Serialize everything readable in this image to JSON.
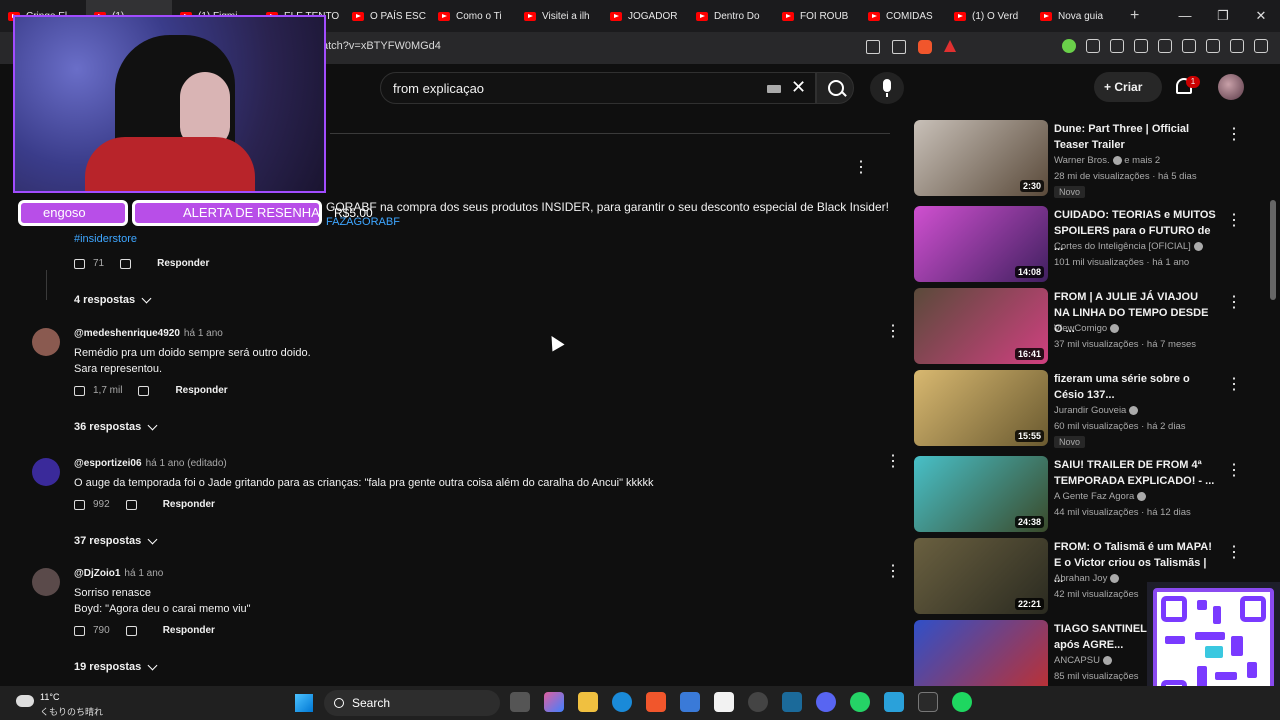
{
  "browser": {
    "tabs": [
      {
        "label": "Cringe El"
      },
      {
        "label": "(1)"
      },
      {
        "label": "(1) Figmi"
      },
      {
        "label": "ELE TENTO"
      },
      {
        "label": "O PAÍS ESC"
      },
      {
        "label": "Como o Ti"
      },
      {
        "label": "Visitei a ilh"
      },
      {
        "label": "JOGADOR"
      },
      {
        "label": "Dentro Do"
      },
      {
        "label": "FOI ROUB"
      },
      {
        "label": "COMIDAS"
      },
      {
        "label": "(1) O Verd"
      },
      {
        "label": "Nova guia"
      }
    ],
    "new_tab": "+",
    "window_controls": {
      "minimize": "—",
      "maximize": "❐",
      "close": "✕"
    },
    "url": "atch?v=xBTYFW0MGd4"
  },
  "header": {
    "search_value": "from explicaçao",
    "clear_icon": "✕",
    "create_label": "Criar",
    "create_plus": "+",
    "notif_count": "1"
  },
  "overlay": {
    "alert_user": "engoso",
    "alert_title": "ALERTA DE RESENHA",
    "alert_amount": "R$5.00"
  },
  "pinned": {
    "text": "GORABF na compra dos seus produtos INSIDER, para garantir o seu desconto especial de Black Insider!",
    "link": "FAZAGORABF",
    "hashtag": "#insiderstore",
    "likes": "71",
    "reply_label": "Responder",
    "replies": "4 respostas"
  },
  "comments": [
    {
      "author": "@medeshenrique4920",
      "when": "há 1 ano",
      "text": "Remédio pra um doido sempre será outro doido.\nSara representou.",
      "likes": "1,7 mil",
      "reply_label": "Responder",
      "replies": "36 respostas",
      "avatar_color": "#8a5a50"
    },
    {
      "author": "@esportizei06",
      "when": "há 1 ano (editado)",
      "text": "O auge da temporada foi o Jade gritando para as crianças: \"fala pra gente outra coisa além do caralha do Ancui\" kkkkk",
      "likes": "992",
      "reply_label": "Responder",
      "replies": "37 respostas",
      "avatar_color": "#3a2a9a"
    },
    {
      "author": "@DjZoio1",
      "when": "há 1 ano",
      "text": "Sorriso renasce\nBoyd: \"Agora deu o carai memo viu\"",
      "likes": "790",
      "reply_label": "Responder",
      "replies": "19 respostas",
      "avatar_color": "#5a4a4a"
    }
  ],
  "recommendations": [
    {
      "title": "Dune: Part Three | Official Teaser Trailer",
      "channel": "Warner Bros.",
      "channel_extra": "e mais 2",
      "meta": "28 mi de visualizações · há 5 dias",
      "duration": "2:30",
      "badge": "Novo",
      "colors": [
        "#c8c0b8",
        "#5a4a3a"
      ]
    },
    {
      "title": "CUIDADO: TEORIAS e MUITOS SPOILERS para o FUTURO de ...",
      "channel": "Cortes do Inteligência [OFICIAL]",
      "meta": "101 mil visualizações · há 1 ano",
      "duration": "14:08",
      "badge": "",
      "colors": [
        "#d050d0",
        "#402060"
      ]
    },
    {
      "title": "FROM | A JULIE JÁ VIAJOU NA LINHA DO TEMPO DESDE O ...",
      "channel": "ViewComigo",
      "meta": "37 mil visualizações · há 7 meses",
      "duration": "16:41",
      "badge": "",
      "colors": [
        "#5a4a3a",
        "#d04080"
      ]
    },
    {
      "title": "fizeram uma série sobre o Césio 137...",
      "channel": "Jurandir Gouveia",
      "meta": "60 mil visualizações · há 2 dias",
      "duration": "15:55",
      "badge": "Novo",
      "colors": [
        "#d8b870",
        "#6a5a30"
      ]
    },
    {
      "title": "SAIU! TRAILER DE FROM 4ª TEMPORADA EXPLICADO! - ...",
      "channel": "A Gente Faz Agora",
      "meta": "44 mil visualizações · há 12 dias",
      "duration": "24:38",
      "badge": "",
      "colors": [
        "#48c0c8",
        "#3a4a2a"
      ]
    },
    {
      "title": "FROM: O Talismã é um MAPA! E o Victor criou os Talismãs | ...",
      "channel": "Abrahan Joy",
      "meta": "42 mil visualizações",
      "duration": "22:21",
      "badge": "",
      "colors": [
        "#6a6040",
        "#2a2a20"
      ]
    },
    {
      "title": "TIAGO SANTINELI PRESO após AGRE...",
      "channel": "ANCAPSU",
      "meta": "85 mil visualizações",
      "duration": "",
      "badge": "",
      "colors": [
        "#3050c8",
        "#c03030"
      ]
    }
  ],
  "taskbar": {
    "temp": "11°C",
    "weather_desc": "くもりのち晴れ",
    "search_label": "Search"
  },
  "colors": {
    "bg": "#0f0f0f",
    "accent_red": "#ff0000",
    "link_blue": "#3ea6ff",
    "overlay_purple": "#b84ee8"
  }
}
